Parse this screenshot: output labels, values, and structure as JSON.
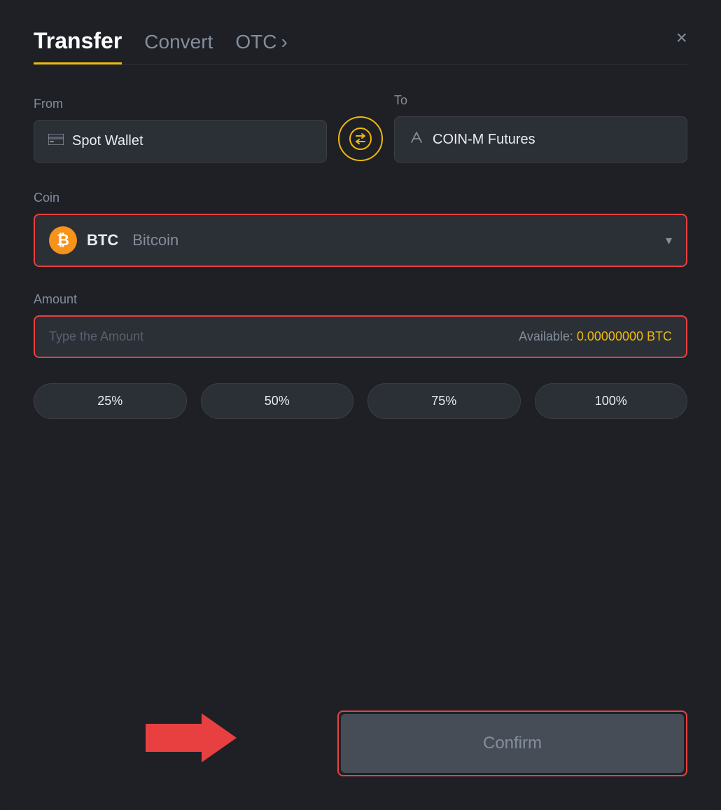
{
  "header": {
    "tab_transfer": "Transfer",
    "tab_convert": "Convert",
    "tab_otc": "OTC",
    "close_label": "×"
  },
  "from": {
    "label": "From",
    "wallet_icon": "▬",
    "wallet_name": "Spot Wallet"
  },
  "swap": {
    "label": "swap"
  },
  "to": {
    "label": "To",
    "futures_name": "COIN-M Futures"
  },
  "coin": {
    "label": "Coin",
    "symbol": "BTC",
    "name": "Bitcoin",
    "icon_letter": "₿"
  },
  "amount": {
    "label": "Amount",
    "placeholder": "Type the Amount",
    "available_label": "Available:",
    "available_value": "0.00000000 BTC"
  },
  "percentages": [
    {
      "label": "25%"
    },
    {
      "label": "50%"
    },
    {
      "label": "75%"
    },
    {
      "label": "100%"
    }
  ],
  "confirm": {
    "label": "Confirm"
  }
}
